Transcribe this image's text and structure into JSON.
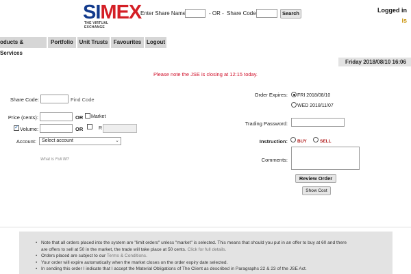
{
  "header": {
    "logo_text_a": "SI",
    "logo_text_b": "MEX",
    "logo_tagline": "THE VIRTUAL EXCHANGE",
    "share_name_label": "Enter Share Name:",
    "or_label": "- OR -",
    "share_code_label": "Share Code:",
    "search_label": "Search",
    "logged_in": "Logged in",
    "logged_in_suffix": "is"
  },
  "nav": {
    "items": [
      "oducts & Services",
      "Portfolio",
      "Unit Trusts",
      "Favourites",
      "Logout"
    ]
  },
  "date": "Friday 2018/08/10 16:06",
  "notice": "Please note the JSE is closing at 12:15 today.",
  "form": {
    "share_code_label": "Share Code:",
    "find_code": "Find Code",
    "price_label": "Price (cents):",
    "or": "OR",
    "market_label": "Market",
    "volume_label": "Volume:",
    "r_label": "R",
    "account_label": "Account:",
    "account_value": "Select account",
    "full_fill": "What is Full fill?",
    "order_expires_label": "Order Expires:",
    "expiry_opt1": "FRI 2018/08/10",
    "expiry_opt2": "WED 2018/11/07",
    "trading_password_label": "Trading Password:",
    "instruction_label": "Instruction:",
    "buy": "BUY",
    "sell": "SELL",
    "comments_label": "Comments:",
    "review_order": "Review Order",
    "show_cost": "Show Cost"
  },
  "colors": {
    "logo_blue": "#123a8c",
    "logo_red": "#d41f26",
    "notice_red": "#d0112b",
    "buy_sell": "#b01818"
  },
  "footer": {
    "line1a": "Note that all orders placed into the system are \"limit orders\" unless \"market\" is selected. This means that should you put in an offer to buy at 60 and there",
    "line1b": "are offers to sell at 50 in the market, the trade will take place at 50 cents.",
    "line1_link": "Click for full details.",
    "line2a": "Orders placed are subject to our",
    "line2_link": "Terms & Conditions.",
    "line3": "Your order will expire automatically when the market closes on the order expiry date selected.",
    "line4": "In sending this order I indicate that I accept the Material Obligations of The Client as described in Paragraphs 22 & 23 of the JSE Act."
  }
}
